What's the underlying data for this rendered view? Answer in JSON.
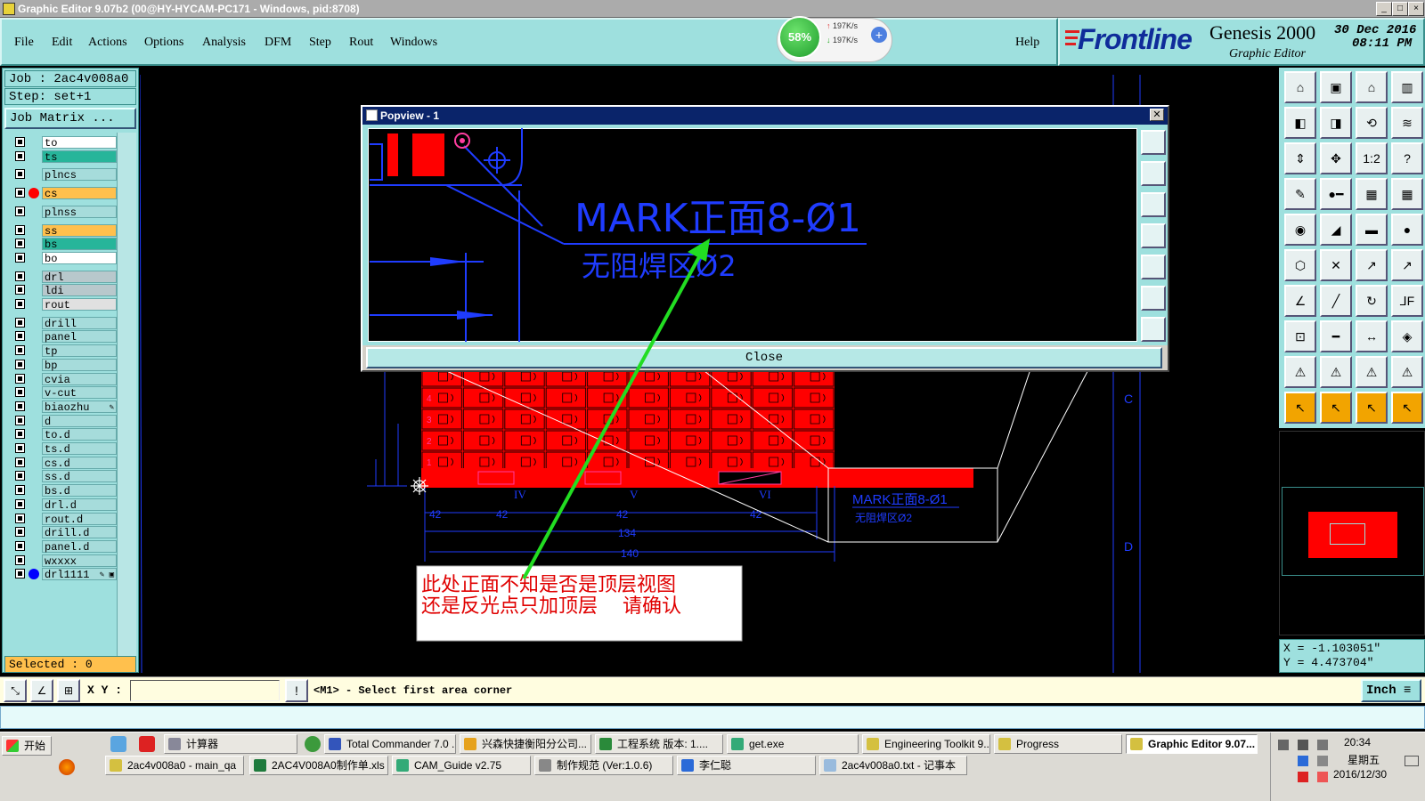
{
  "window": {
    "title": "Graphic Editor 9.07b2 (00@HY-HYCAM-PC171 - Windows, pid:8708)"
  },
  "menu": [
    "File",
    "Edit",
    "Actions",
    "Options",
    "Analysis",
    "DFM",
    "Step",
    "Rout",
    "Windows"
  ],
  "help_label": "Help",
  "netmeter": {
    "percent": "58%",
    "up": "197K/s",
    "down": "197K/s"
  },
  "brand": {
    "logo": "Frontline",
    "product": "Genesis 2000",
    "subtitle": "Graphic Editor",
    "date": "30 Dec 2016",
    "time": "08:11 PM"
  },
  "job": {
    "job_label": "Job : 2ac4v008a0",
    "step_label": "Step: set+1",
    "matrix_button": "Job Matrix ..."
  },
  "layers": [
    {
      "name": "to",
      "color": "#ffffff"
    },
    {
      "name": "ts",
      "color": "#27b59a"
    },
    {
      "name": "plncs",
      "color": "#a6dcdb"
    },
    {
      "name": "cs",
      "color": "#ffc04d",
      "marker": "#ff0000"
    },
    {
      "name": "plnss",
      "color": "#a6dcdb"
    },
    {
      "name": "ss",
      "color": "#ffc04d"
    },
    {
      "name": "bs",
      "color": "#27b59a"
    },
    {
      "name": "bo",
      "color": "#ffffff"
    },
    {
      "name": "drl",
      "color": "#b8c8cc"
    },
    {
      "name": "ldi",
      "color": "#b8c8cc"
    },
    {
      "name": "rout",
      "color": "#e0e0e0"
    },
    {
      "name": "drill",
      "color": "#a6dcdb"
    },
    {
      "name": "panel",
      "color": "#a6dcdb"
    },
    {
      "name": "tp",
      "color": "#a6dcdb"
    },
    {
      "name": "bp",
      "color": "#a6dcdb"
    },
    {
      "name": "cvia",
      "color": "#a6dcdb"
    },
    {
      "name": "v-cut",
      "color": "#a6dcdb"
    },
    {
      "name": "biaozhu",
      "color": "#a6dcdb",
      "mark": "✎"
    },
    {
      "name": "d",
      "color": "#a6dcdb"
    },
    {
      "name": "to.d",
      "color": "#a6dcdb"
    },
    {
      "name": "ts.d",
      "color": "#a6dcdb"
    },
    {
      "name": "cs.d",
      "color": "#a6dcdb"
    },
    {
      "name": "ss.d",
      "color": "#a6dcdb"
    },
    {
      "name": "bs.d",
      "color": "#a6dcdb"
    },
    {
      "name": "drl.d",
      "color": "#a6dcdb"
    },
    {
      "name": "rout.d",
      "color": "#a6dcdb"
    },
    {
      "name": "drill.d",
      "color": "#a6dcdb"
    },
    {
      "name": "panel.d",
      "color": "#a6dcdb"
    },
    {
      "name": "wxxxx",
      "color": "#a6dcdb"
    },
    {
      "name": "drl1111",
      "color": "#a6dcdb",
      "marker": "#0000ff",
      "mark": "✎ ▣"
    }
  ],
  "selected_label": "Selected : 0",
  "command": {
    "xy_label": "X Y :",
    "xy_value": "",
    "prompt": "<M1> - Select first area corner",
    "units": "Inch"
  },
  "coords": {
    "x": "X = -1.103051\"",
    "y": "Y = 4.473704\""
  },
  "popview": {
    "title": "Popview - 1",
    "mark_text": "MARK正面8-Ø1",
    "sub_text": "无阻焊区Ø2",
    "close_label": "Close"
  },
  "canvas": {
    "dims": [
      "42",
      "42",
      "42",
      "134",
      "140"
    ],
    "row_labels": [
      "4",
      "3",
      "2",
      "1"
    ],
    "roman": [
      "IV",
      "V",
      "VI"
    ],
    "mark_small": "MARK正面8-Ø1",
    "sub_small": "无阻焊区Ø2",
    "zone_labels": [
      "C",
      "D"
    ]
  },
  "annotation": {
    "line1": "此处正面不知是否是顶层视图",
    "line2": "还是反光点只加顶层    请确认"
  },
  "taskbar": {
    "start": "开始",
    "row1": [
      "计算器",
      "Total Commander 7.0 ...",
      "兴森快捷衡阳分公司...",
      "工程系统  版本: 1....",
      "get.exe",
      "Engineering Toolkit 9....",
      "Progress",
      "Graphic Editor 9.07..."
    ],
    "row2": [
      "2ac4v008a0 - main_qa",
      "2AC4V008A0制作单.xls ...",
      "CAM_Guide v2.75",
      "制作规范 (Ver:1.0.6)",
      "李仁聪",
      "2ac4v008a0.txt - 记事本"
    ],
    "clock_time": "20:34",
    "clock_day": "星期五",
    "clock_date": "2016/12/30"
  },
  "right_toolbar_icons": [
    "home-icon",
    "zoom-icon",
    "pan-icon",
    "redraw-icon",
    "1:2",
    "help-icon"
  ],
  "colors": {
    "panel": "#9ee0de",
    "canvas": "#000000",
    "board": "#ff0000",
    "cad_blue": "#1f3cff",
    "arrow": "#22dd22"
  }
}
